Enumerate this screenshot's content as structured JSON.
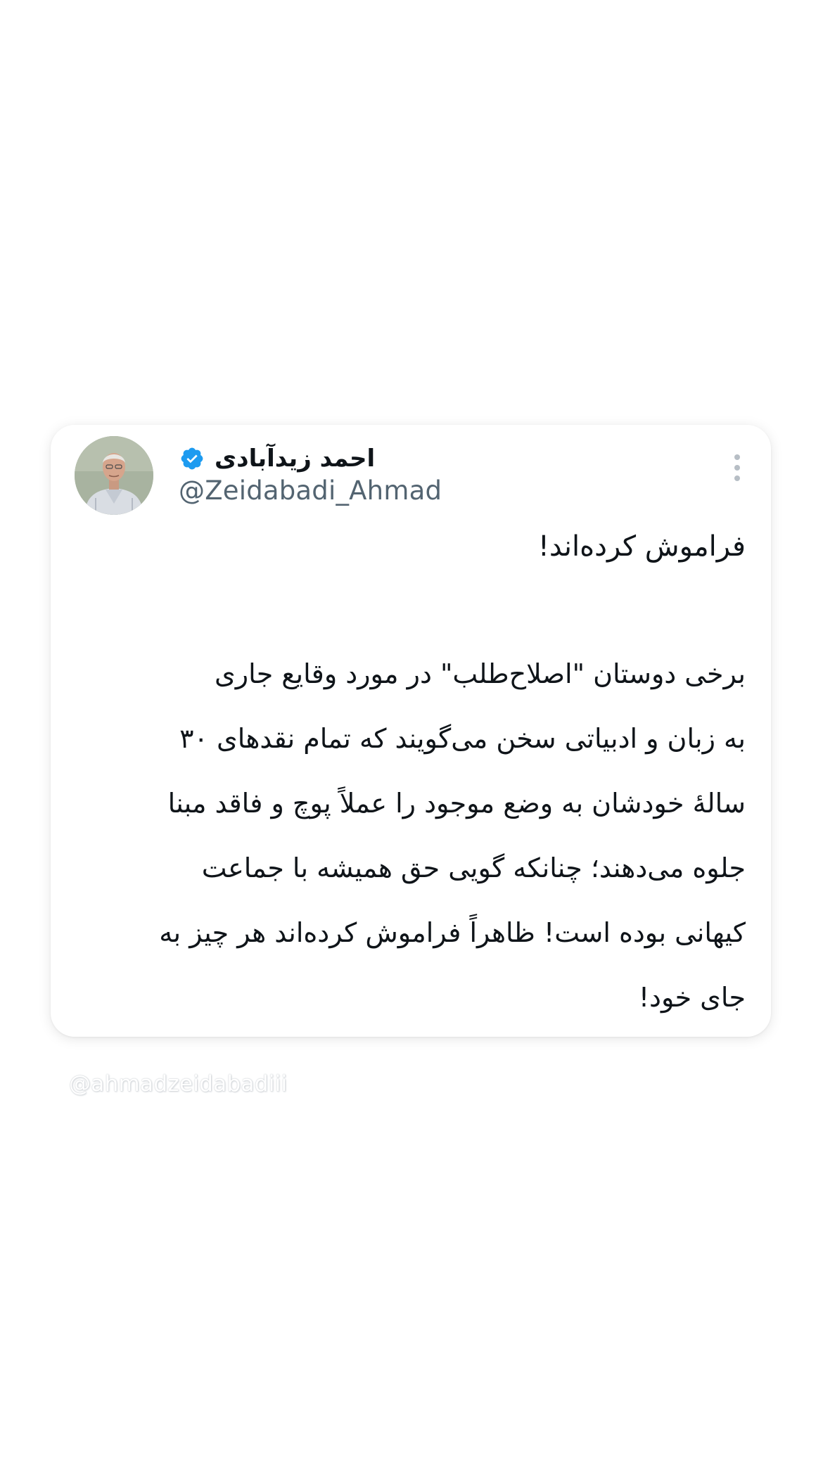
{
  "tweet": {
    "author_name": "احمد زیدآبادی",
    "handle": "@Zeidabadi_Ahmad",
    "verified_icon": "verified-badge-icon",
    "more_icon": "more-vertical-icon",
    "accent_color": "#1d9bf0",
    "title": "فراموش کرده‌اند!",
    "body_lines": [
      "برخی دوستان \"اصلاح‌طلب\" در مورد وقایع جاری",
      "به زبان و ادبیاتی سخن می‌گویند که تمام نقدهای ۳۰",
      "سالهٔ خودشان به وضع موجود را عملاً پوچ و فاقد مبنا",
      "جلوه می‌دهند؛ چنانکه گویی حق همیشه با جماعت",
      "کیهانی بوده است! ظاهراً فراموش کرده‌اند هر چیز به",
      "جای خود!"
    ]
  },
  "watermark": "@ahmadzeidabadiii"
}
